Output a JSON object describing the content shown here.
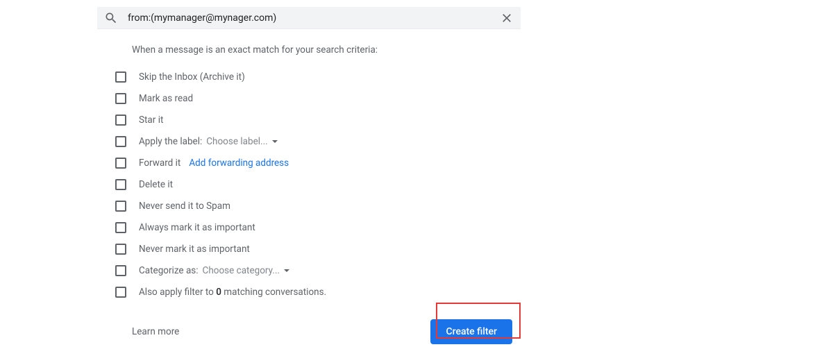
{
  "search": {
    "query": "from:(mymanager@mynager.com)"
  },
  "instruction": "When a message is an exact match for your search criteria:",
  "options": {
    "skip_inbox": "Skip the Inbox (Archive it)",
    "mark_read": "Mark as read",
    "star": "Star it",
    "apply_label": "Apply the label:",
    "apply_label_dropdown": "Choose label...",
    "forward": "Forward it",
    "forward_link": "Add forwarding address",
    "delete": "Delete it",
    "never_spam": "Never send it to Spam",
    "always_important": "Always mark it as important",
    "never_important": "Never mark it as important",
    "categorize": "Categorize as:",
    "categorize_dropdown": "Choose category...",
    "also_apply_prefix": "Also apply filter to ",
    "also_apply_count": "0",
    "also_apply_suffix": " matching conversations."
  },
  "footer": {
    "learn_more": "Learn more",
    "create_filter": "Create filter"
  }
}
